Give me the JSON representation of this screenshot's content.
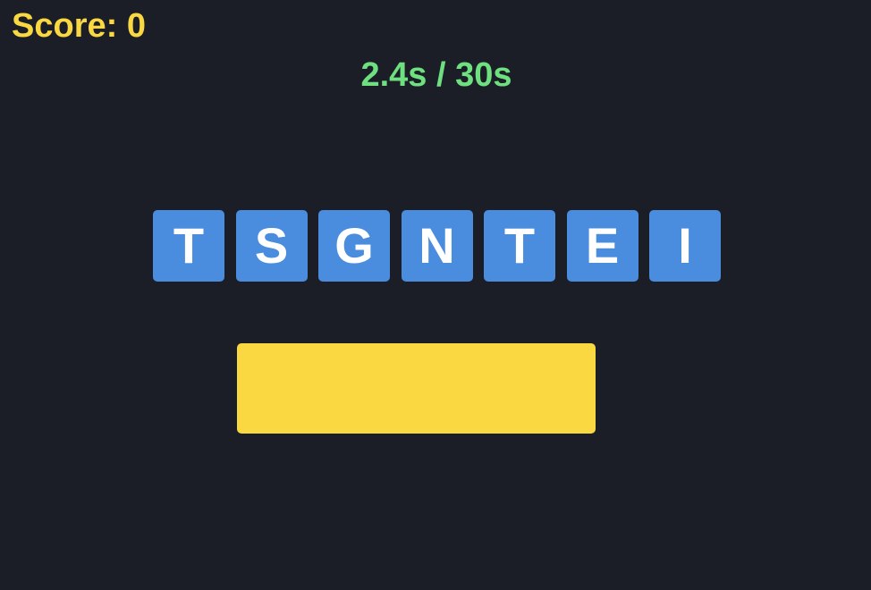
{
  "hud": {
    "score_text": "Score: 0",
    "timer_text": "2.4s / 30s"
  },
  "colors": {
    "background": "#1b1e27",
    "score": "#fad841",
    "timer": "#6ee07f",
    "tile": "#4a8ddf",
    "tile_text": "#ffffff",
    "answer_box": "#fad841"
  },
  "tiles": [
    "T",
    "S",
    "G",
    "N",
    "T",
    "E",
    "I"
  ],
  "answer": {
    "value": ""
  }
}
